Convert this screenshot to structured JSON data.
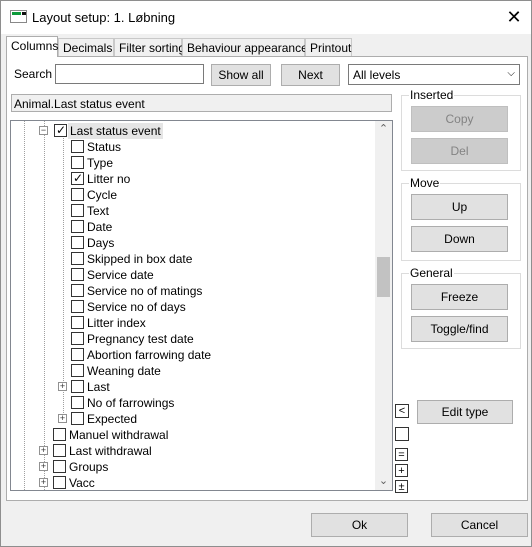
{
  "window": {
    "title": "Layout setup: 1. Løbning"
  },
  "tabs": [
    "Columns",
    "Decimals",
    "Filter sorting",
    "Behaviour  appearance",
    "Printout"
  ],
  "search": {
    "label": "Search",
    "value": "",
    "show_all": "Show all",
    "next": "Next",
    "level": "All levels"
  },
  "path": "Animal.Last status event",
  "tree": {
    "parent": "Last status event",
    "children": [
      {
        "label": "Status",
        "checked": false
      },
      {
        "label": "Type",
        "checked": false
      },
      {
        "label": "Litter no",
        "checked": true
      },
      {
        "label": "Cycle",
        "checked": false
      },
      {
        "label": "Text",
        "checked": false
      },
      {
        "label": "Date",
        "checked": false
      },
      {
        "label": "Days",
        "checked": false
      },
      {
        "label": "Skipped in box date",
        "checked": false
      },
      {
        "label": "Service date",
        "checked": false
      },
      {
        "label": "Service no of matings",
        "checked": false
      },
      {
        "label": "Service no of days",
        "checked": false
      },
      {
        "label": "Litter index",
        "checked": false
      },
      {
        "label": "Pregnancy test date",
        "checked": false
      },
      {
        "label": "Abortion farrowing date",
        "checked": false
      },
      {
        "label": "Weaning date",
        "checked": false
      },
      {
        "label": "Last",
        "checked": false
      },
      {
        "label": "No of farrowings",
        "checked": false
      },
      {
        "label": "Expected",
        "checked": false
      }
    ],
    "siblings": [
      {
        "label": "Manuel withdrawal"
      },
      {
        "label": "Last withdrawal"
      },
      {
        "label": "Groups"
      },
      {
        "label": "Vacc"
      }
    ]
  },
  "groups": {
    "inserted": {
      "title": "Inserted",
      "copy": "Copy",
      "del": "Del"
    },
    "move": {
      "title": "Move",
      "up": "Up",
      "down": "Down"
    },
    "general": {
      "title": "General",
      "freeze": "Freeze",
      "toggle": "Toggle/find"
    }
  },
  "side_buttons": {
    "edit_type": "Edit type",
    "minus": "=",
    "plus": "+",
    "plusminus": "±"
  },
  "footer": {
    "ok": "Ok",
    "cancel": "Cancel"
  }
}
